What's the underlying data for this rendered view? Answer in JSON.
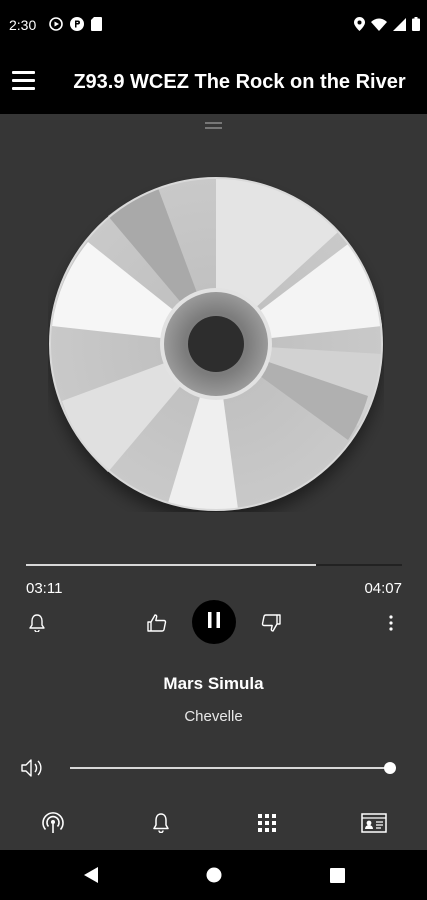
{
  "status_bar": {
    "time": "2:30",
    "left_icons": [
      "record-icon",
      "parking-app-icon",
      "sim-card-icon"
    ],
    "right_icons": [
      "location-icon",
      "wifi-icon",
      "signal-icon",
      "battery-icon"
    ]
  },
  "app_bar": {
    "title": "Z93.9 WCEZ The Rock on the River",
    "menu_icon": "hamburger-menu-icon"
  },
  "player": {
    "album_art": "compact-disc-placeholder",
    "progress": {
      "elapsed": "03:11",
      "total": "04:07",
      "fraction": 0.77
    },
    "controls": {
      "alarm_icon": "bell-icon",
      "like_icon": "thumbs-up-icon",
      "play_state": "playing",
      "play_pause_icon": "pause-icon",
      "dislike_icon": "thumbs-down-icon",
      "more_icon": "more-vertical-icon"
    },
    "track": {
      "title": "Mars Simula",
      "artist": "Chevelle"
    },
    "volume": {
      "icon": "speaker-icon",
      "level": 1.0
    }
  },
  "bottom_tabs": [
    {
      "name": "live",
      "icon": "broadcast-icon"
    },
    {
      "name": "alarm",
      "icon": "bell-icon"
    },
    {
      "name": "apps",
      "icon": "grid-icon"
    },
    {
      "name": "contact",
      "icon": "contact-card-icon"
    }
  ],
  "nav_bar": [
    "back-icon",
    "home-icon",
    "recents-icon"
  ],
  "colors": {
    "background": "#363636",
    "bars": "#000000",
    "text": "#ffffff",
    "progress_fill": "#d8d8d8"
  }
}
